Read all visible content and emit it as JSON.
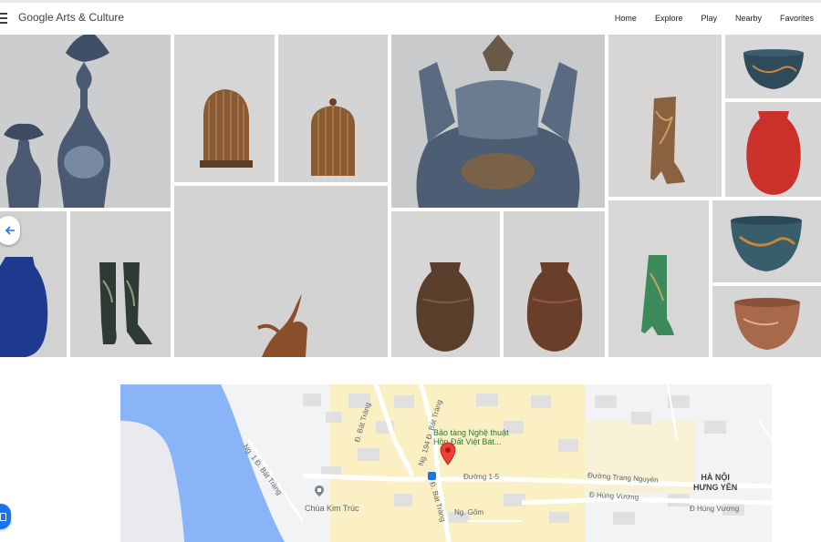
{
  "header": {
    "logo": "Google Arts & Culture",
    "nav": [
      "Home",
      "Explore",
      "Play",
      "Nearby",
      "Favorites"
    ]
  },
  "gallery": {
    "items": [
      {
        "subject": "vase-pair",
        "bg": "#cbcdcf"
      },
      {
        "subject": "birdcage",
        "bg": "#d6d6d6"
      },
      {
        "subject": "lidded-jar",
        "bg": "#d4d4d4"
      },
      {
        "subject": "ornate-censer",
        "bg": "#c9cacb"
      },
      {
        "subject": "heeled-boot",
        "bg": "#d7d6d5"
      },
      {
        "subject": "bowl",
        "bg": "#d8d8d8"
      },
      {
        "subject": "red-vase",
        "bg": "#d6d6d6"
      },
      {
        "subject": "blue-vase",
        "bg": "#d2d2d2"
      },
      {
        "subject": "boots",
        "bg": "#d3d3d3"
      },
      {
        "subject": "branch-sculpture",
        "bg": "#d3d3d3"
      },
      {
        "subject": "brown-vase",
        "bg": "#d6d6d6"
      },
      {
        "subject": "brown-vase",
        "bg": "#d4d4d4"
      },
      {
        "subject": "green-boot",
        "bg": "#d7d7d7"
      },
      {
        "subject": "painted-bowl",
        "bg": "#d5d5d5"
      },
      {
        "subject": "painted-bowl-2",
        "bg": "#d6d6d6"
      }
    ]
  },
  "map": {
    "poi": "Bảo tàng Nghệ thuật Hồn Đất Việt Bát...",
    "temple": "Chùa Kim Trúc",
    "region": [
      "HÀ NỘI",
      "HƯNG YÊN"
    ],
    "streets": [
      "Đ. Bát Tràng",
      "Ng. 194 Đ. Bát Tràng",
      "Ng. 1 Đ. Bát Tràng",
      "Đường 1-5",
      "Đường Trang Nguyên",
      "Đ Hùng Vương",
      "Đ Hùng Vương",
      "Ng. Gốm",
      "Đ. Bát Tràng"
    ]
  },
  "colors": {
    "river": "#8ab4f8",
    "block": "#e8eaed",
    "yellow": "#fdf3c7",
    "pin": "#ea4335",
    "accent": "#1a73e8"
  }
}
